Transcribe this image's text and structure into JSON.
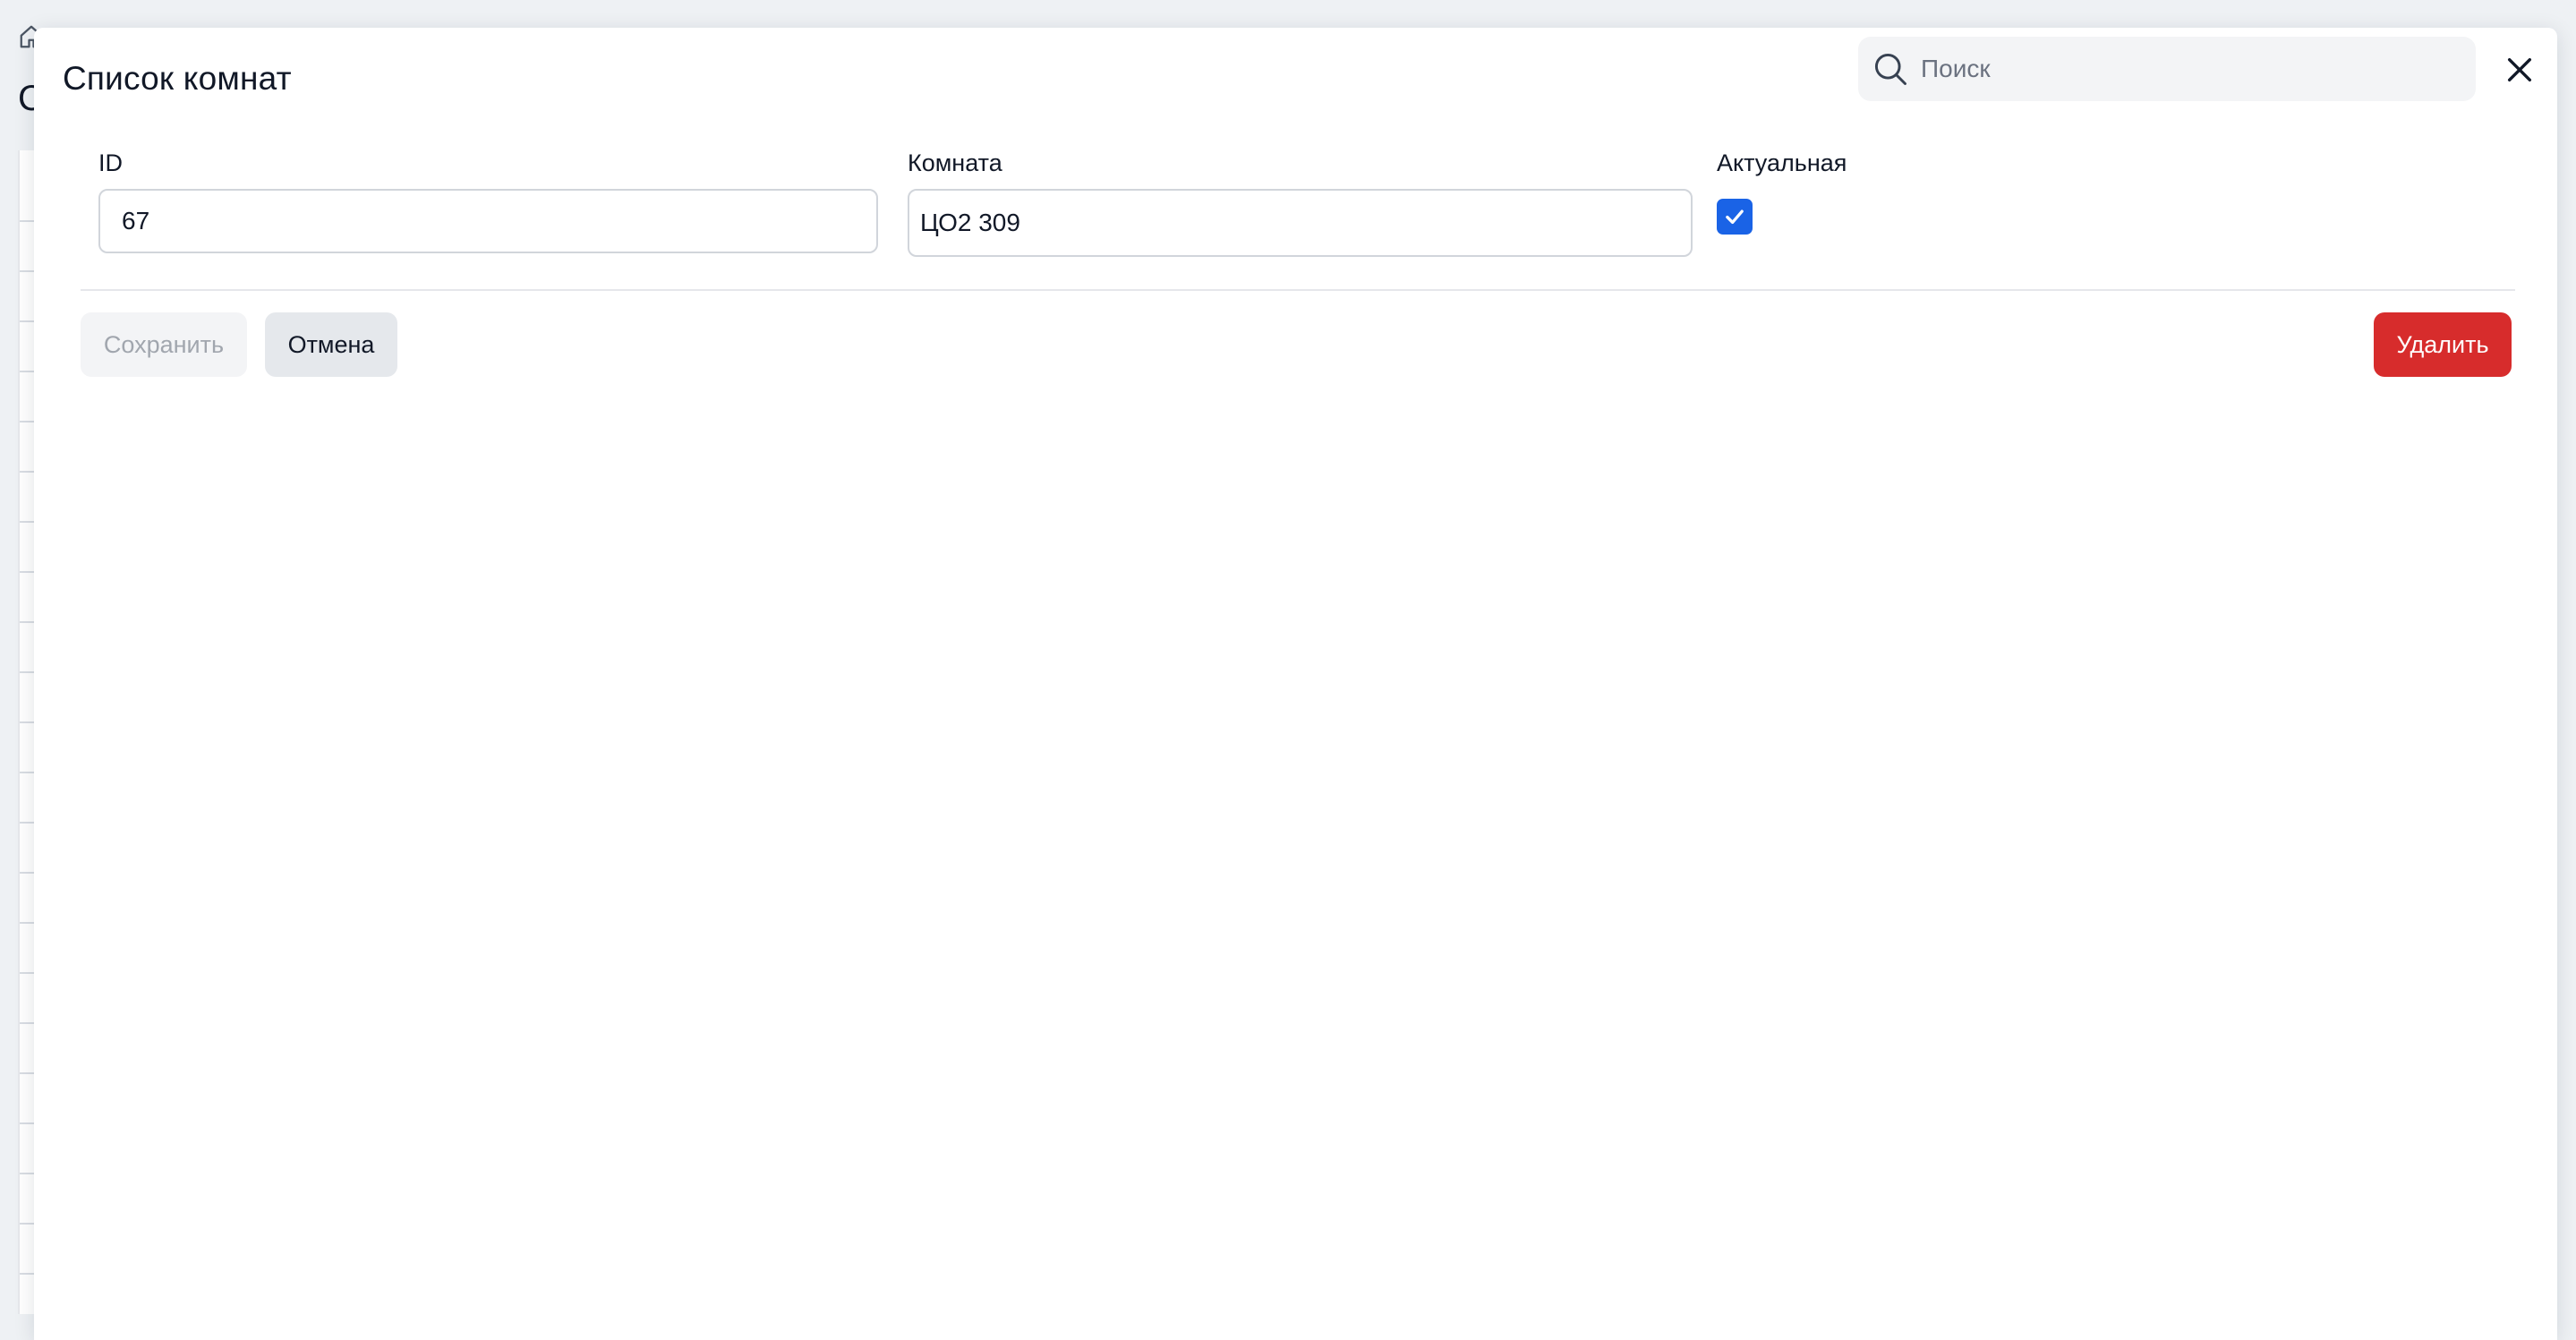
{
  "modal": {
    "title": "Список комнат",
    "search": {
      "placeholder": "Поиск",
      "value": ""
    }
  },
  "form": {
    "id": {
      "label": "ID",
      "value": "67"
    },
    "room": {
      "label": "Комната",
      "value": "ЦО2 309"
    },
    "active": {
      "label": "Актуальная",
      "checked": true
    }
  },
  "actions": {
    "save_label": "Сохранить",
    "cancel_label": "Отмена",
    "delete_label": "Удалить"
  },
  "background": {
    "title_fragment": "С"
  },
  "colors": {
    "primary": "#1a63e6",
    "danger": "#d72c2c",
    "input_border": "#d1d5db",
    "disabled_text": "#a1a6ae"
  },
  "icons": {
    "search": "search-icon",
    "close": "close-icon",
    "check": "checkmark-icon",
    "home": "home-icon"
  }
}
